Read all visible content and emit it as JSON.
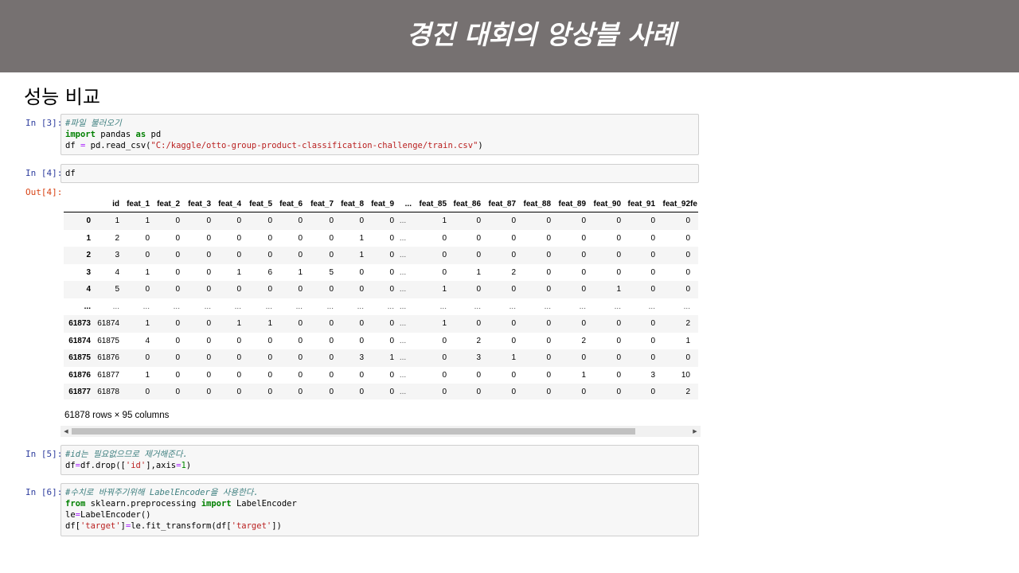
{
  "slide": {
    "title": "경진 대회의 앙상블 사례",
    "subtitle": "성능 비교"
  },
  "cells": [
    {
      "prompt": "In [3]:",
      "lines": [
        [
          {
            "t": "#파일 불러오기",
            "c": "cm"
          }
        ],
        [
          {
            "t": "import",
            "c": "kw"
          },
          {
            "t": " pandas "
          },
          {
            "t": "as",
            "c": "kw"
          },
          {
            "t": " pd"
          }
        ],
        [
          {
            "t": "df "
          },
          {
            "t": "=",
            "c": "op"
          },
          {
            "t": " pd.read_csv("
          },
          {
            "t": "\"C:/kaggle/otto-group-product-classification-challenge/train.csv\"",
            "c": "str"
          },
          {
            "t": ")"
          }
        ]
      ]
    },
    {
      "prompt": "In [4]:",
      "lines": [
        [
          {
            "t": "df"
          }
        ]
      ]
    },
    {
      "prompt": "In [5]:",
      "lines": [
        [
          {
            "t": "#id는 필요없으므로 제거해준다.",
            "c": "cm"
          }
        ],
        [
          {
            "t": "df"
          },
          {
            "t": "=",
            "c": "op"
          },
          {
            "t": "df.drop(["
          },
          {
            "t": "'id'",
            "c": "str"
          },
          {
            "t": "],axis"
          },
          {
            "t": "=",
            "c": "op"
          },
          {
            "t": "1",
            "c": "num"
          },
          {
            "t": ")"
          }
        ]
      ]
    },
    {
      "prompt": "In [6]:",
      "lines": [
        [
          {
            "t": "#수치로 바꿔주기위해 LabelEncoder을 사용한다.",
            "c": "cm"
          }
        ],
        [
          {
            "t": "from",
            "c": "kw"
          },
          {
            "t": " sklearn.preprocessing "
          },
          {
            "t": "import",
            "c": "kw"
          },
          {
            "t": " LabelEncoder"
          }
        ],
        [
          {
            "t": "le"
          },
          {
            "t": "=",
            "c": "op"
          },
          {
            "t": "LabelEncoder()"
          }
        ],
        [
          {
            "t": "df["
          },
          {
            "t": "'target'",
            "c": "str"
          },
          {
            "t": "]"
          },
          {
            "t": "=",
            "c": "op"
          },
          {
            "t": "le.fit_transform(df["
          },
          {
            "t": "'target'",
            "c": "str"
          },
          {
            "t": "])"
          }
        ]
      ]
    }
  ],
  "output": {
    "prompt": "Out[4]:",
    "columns": [
      "",
      "id",
      "feat_1",
      "feat_2",
      "feat_3",
      "feat_4",
      "feat_5",
      "feat_6",
      "feat_7",
      "feat_8",
      "feat_9",
      "...",
      "feat_85",
      "feat_86",
      "feat_87",
      "feat_88",
      "feat_89",
      "feat_90",
      "feat_91",
      "feat_92",
      "fe"
    ],
    "rows": [
      [
        "0",
        "1",
        "1",
        "0",
        "0",
        "0",
        "0",
        "0",
        "0",
        "0",
        "0",
        "...",
        "1",
        "0",
        "0",
        "0",
        "0",
        "0",
        "0",
        "0"
      ],
      [
        "1",
        "2",
        "0",
        "0",
        "0",
        "0",
        "0",
        "0",
        "0",
        "1",
        "0",
        "...",
        "0",
        "0",
        "0",
        "0",
        "0",
        "0",
        "0",
        "0"
      ],
      [
        "2",
        "3",
        "0",
        "0",
        "0",
        "0",
        "0",
        "0",
        "0",
        "1",
        "0",
        "...",
        "0",
        "0",
        "0",
        "0",
        "0",
        "0",
        "0",
        "0"
      ],
      [
        "3",
        "4",
        "1",
        "0",
        "0",
        "1",
        "6",
        "1",
        "5",
        "0",
        "0",
        "...",
        "0",
        "1",
        "2",
        "0",
        "0",
        "0",
        "0",
        "0"
      ],
      [
        "4",
        "5",
        "0",
        "0",
        "0",
        "0",
        "0",
        "0",
        "0",
        "0",
        "0",
        "...",
        "1",
        "0",
        "0",
        "0",
        "0",
        "1",
        "0",
        "0"
      ],
      [
        "...",
        "...",
        "...",
        "...",
        "...",
        "...",
        "...",
        "...",
        "...",
        "...",
        "...",
        "...",
        "...",
        "...",
        "...",
        "...",
        "...",
        "...",
        "...",
        "..."
      ],
      [
        "61873",
        "61874",
        "1",
        "0",
        "0",
        "1",
        "1",
        "0",
        "0",
        "0",
        "0",
        "...",
        "1",
        "0",
        "0",
        "0",
        "0",
        "0",
        "0",
        "2"
      ],
      [
        "61874",
        "61875",
        "4",
        "0",
        "0",
        "0",
        "0",
        "0",
        "0",
        "0",
        "0",
        "...",
        "0",
        "2",
        "0",
        "0",
        "2",
        "0",
        "0",
        "1"
      ],
      [
        "61875",
        "61876",
        "0",
        "0",
        "0",
        "0",
        "0",
        "0",
        "0",
        "3",
        "1",
        "...",
        "0",
        "3",
        "1",
        "0",
        "0",
        "0",
        "0",
        "0"
      ],
      [
        "61876",
        "61877",
        "1",
        "0",
        "0",
        "0",
        "0",
        "0",
        "0",
        "0",
        "0",
        "...",
        "0",
        "0",
        "0",
        "0",
        "1",
        "0",
        "3",
        "10"
      ],
      [
        "61877",
        "61878",
        "0",
        "0",
        "0",
        "0",
        "0",
        "0",
        "0",
        "0",
        "0",
        "...",
        "0",
        "0",
        "0",
        "0",
        "0",
        "0",
        "0",
        "2"
      ]
    ],
    "shape": "61878 rows × 95 columns"
  },
  "colors": {
    "header_bg": "#767171",
    "prompt_in": "#303f9f",
    "prompt_out": "#d84315",
    "comment": "#408080",
    "keyword": "#008000",
    "string": "#ba2121"
  }
}
